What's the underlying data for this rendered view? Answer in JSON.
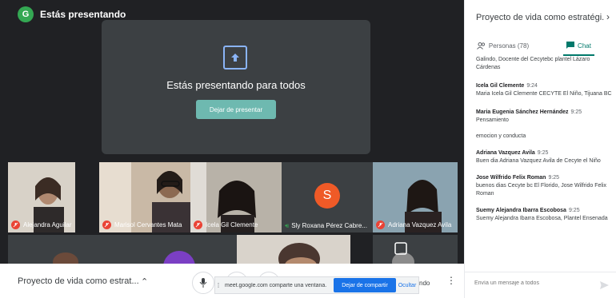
{
  "meeting": {
    "presenting_label": "Estás presentando",
    "presenter_initial": "G",
    "presenting_title": "Estás presentando para todos",
    "stop_presenting_label": "Dejar de presentar",
    "name": "Proyecto de vida como estrat...",
    "bottom_right_label": "ndo"
  },
  "participants": [
    {
      "name": "Alejandra Aguilar",
      "muted": true
    },
    {
      "name": "Marisol Cervantes Mata",
      "muted": true
    },
    {
      "name": "Icela Gil Clemente",
      "muted": true
    },
    {
      "name": "Sly Roxana Pérez Cabre...",
      "muted": false,
      "initial": "S"
    },
    {
      "name": "Adriana Vazquez Avila",
      "muted": true
    }
  ],
  "share_bar": {
    "message": "meet.google.com comparte una ventana.",
    "stop_label": "Dejar de compartir",
    "hide_label": "Ocultar"
  },
  "panel": {
    "title": "Proyecto de vida como estratégi...",
    "close_glyph": "›",
    "people_tab": "Personas (78)",
    "chat_tab": "Chat",
    "composer_placeholder": "Envía un mensaje a todos"
  },
  "messages": [
    {
      "author": "",
      "time": "",
      "text": "Galindo, Docente del Cecytebc plantel Lázaro Cárdenas"
    },
    {
      "author": "Icela Gil Clemente",
      "time": "9:24",
      "text": "Maria Icela Gil Clemente  CECYTE El Niño, Tijuana BC"
    },
    {
      "author": "Maria Eugenia Sánchez Hernández",
      "time": "9:25",
      "text": "Pensamiento"
    },
    {
      "author": "",
      "time": "",
      "text": "emocion y conducta"
    },
    {
      "author": "Adriana Vazquez Avila",
      "time": "9:25",
      "text": "Buen dia Adriana Vazquez Avila de Cecyte el Niño"
    },
    {
      "author": "Jose Wilfrido Felix Roman",
      "time": "9:25",
      "text": " buenos dias Cecyte bc El Florido, Jose Wilfrido Felix Roman"
    },
    {
      "author": "Suemy Alejandra Ibarra Escobosa",
      "time": "9:25",
      "text": "Suemy Alejandra Ibarra Escobosa,  Plantel Ensenada"
    }
  ]
}
